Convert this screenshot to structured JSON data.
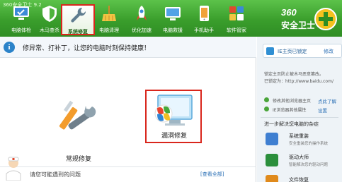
{
  "app": {
    "version": "360安全卫士 9.2",
    "brand_num": "360",
    "brand_name": "安全卫士"
  },
  "toolbar": {
    "items": [
      {
        "label": "电脑体检",
        "icon": "computer-check-icon"
      },
      {
        "label": "木马查杀",
        "icon": "shield-icon"
      },
      {
        "label": "系统修复",
        "icon": "wrench-icon"
      },
      {
        "label": "电脑清理",
        "icon": "broom-icon"
      },
      {
        "label": "优化加速",
        "icon": "rocket-icon"
      },
      {
        "label": "电脑救援",
        "icon": "monitor-icon"
      },
      {
        "label": "手机助手",
        "icon": "phone-icon"
      },
      {
        "label": "软件管家",
        "icon": "apps-icon"
      }
    ],
    "active_index": 2
  },
  "tip": {
    "icon": "info-icon",
    "text": "修异常、打补丁，让您的电脑时刻保持健康！"
  },
  "repair": {
    "normal_label": "常规修复",
    "vuln_label": "漏洞修复"
  },
  "faq": {
    "text": "请您可能遇到的问题",
    "link": "[查看全部]"
  },
  "side": {
    "home_title": "IE主页已锁定",
    "home_edit": "修改",
    "line1": "锁定主页防止被木马恶意篡改。",
    "line2": "已锁定为：http://www.baidu.com/",
    "item1": "修改其他浏览器主页",
    "item1_link": "点此了解",
    "item2": "IE浏览器其他属性",
    "item2_link": "设置",
    "more_title": "进一步解决您电脑的杂症",
    "software": [
      {
        "name": "系统重装",
        "desc": "安全重装您的操作系统",
        "color": "#3f7fd1"
      },
      {
        "name": "驱动大师",
        "desc": "智能解决您的驱动问题",
        "color": "#2b8f3c"
      },
      {
        "name": "文件恢复",
        "desc": "",
        "color": "#e08a1c"
      }
    ]
  },
  "colors": {
    "toolbar_green": "#3a9e2c",
    "highlight_red": "#d9261c",
    "link_blue": "#2a6fb5"
  }
}
